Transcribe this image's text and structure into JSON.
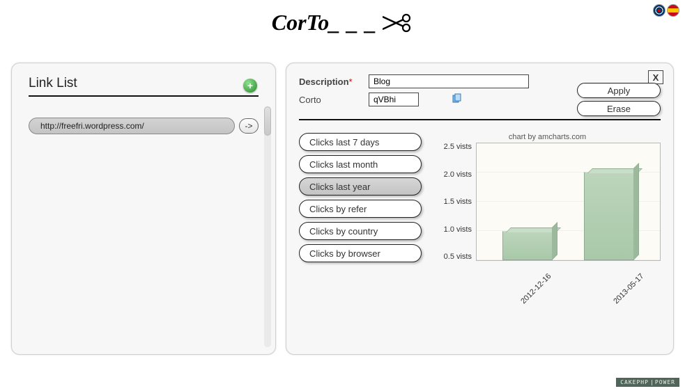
{
  "header": {
    "logo_text": "CorTo",
    "flags": {
      "uk": "English",
      "es": "Español"
    }
  },
  "left": {
    "title": "Link List",
    "add_tooltip": "Add",
    "links": [
      {
        "url": "http://freefri.wordpress.com/",
        "go": "->"
      }
    ]
  },
  "right": {
    "close": "X",
    "fields": {
      "description_label": "Description",
      "required_mark": "*",
      "description_value": "Blog",
      "corto_label": "Corto",
      "corto_value": "qVBhi",
      "copy_tooltip": "Copy"
    },
    "buttons": {
      "apply": "Apply",
      "erase": "Erase"
    },
    "stats": {
      "options": [
        {
          "label": "Clicks last 7 days",
          "active": false
        },
        {
          "label": "Clicks last month",
          "active": false
        },
        {
          "label": "Clicks last year",
          "active": true
        },
        {
          "label": "Clicks by refer",
          "active": false
        },
        {
          "label": "Clicks by country",
          "active": false
        },
        {
          "label": "Clicks by browser",
          "active": false
        }
      ]
    }
  },
  "chart_data": {
    "type": "bar",
    "title": "chart by amcharts.com",
    "ylabel": "vists",
    "ylim": [
      0.5,
      2.5
    ],
    "y_ticks": [
      "2.5 vists",
      "2.0 vists",
      "1.5 vists",
      "1.0 vists",
      "0.5 vists"
    ],
    "categories": [
      "2012-12-16",
      "2013-05-17"
    ],
    "values": [
      1.0,
      2.0
    ]
  },
  "footer": {
    "badge_a": "CAKEPHP",
    "badge_b": "POWER"
  }
}
